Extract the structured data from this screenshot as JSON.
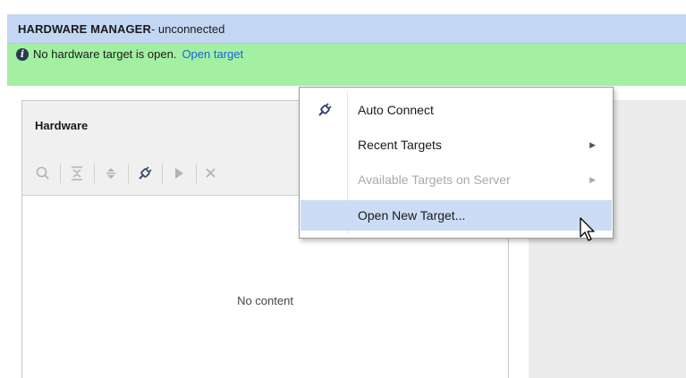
{
  "title_bar": {
    "title": "HARDWARE MANAGER",
    "status": " - unconnected"
  },
  "info_bar": {
    "message": "No hardware target is open.",
    "link": "Open target"
  },
  "hardware_panel": {
    "title": "Hardware",
    "empty_text": "No content",
    "toolbar_icons": [
      "search-icon",
      "collapse-all-icon",
      "expand-all-icon",
      "auto-connect-icon",
      "run-icon",
      "close-icon"
    ]
  },
  "context_menu": {
    "items": [
      {
        "label": "Auto Connect",
        "icon": "auto-connect-icon",
        "submenu": false,
        "enabled": true
      },
      {
        "label": "Recent Targets",
        "submenu": true,
        "enabled": true
      },
      {
        "label": "Available Targets on Server",
        "submenu": true,
        "enabled": false
      },
      {
        "label": "Open New Target...",
        "submenu": false,
        "enabled": true,
        "hovered": true
      }
    ],
    "submenu_arrow": "▶"
  },
  "colors": {
    "title_bar_bg": "#c3d6f3",
    "info_bar_bg": "#a3f0a3",
    "link": "#1565d8",
    "menu_hover": "#ccdcf4"
  }
}
